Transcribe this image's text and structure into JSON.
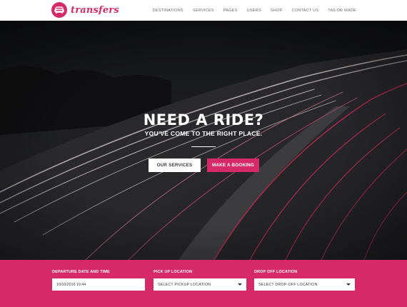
{
  "brand": {
    "name": "transfers",
    "accent": "#d52a67"
  },
  "nav": {
    "items": [
      "Destinations",
      "Services",
      "Pages",
      "Users",
      "Shop",
      "Contact us",
      "Tailor made"
    ]
  },
  "hero": {
    "title": "NEED A RIDE?",
    "subtitle": "YOU'VE COME TO THE RIGHT PLACE.",
    "primary_button": "OUR SERVICES",
    "secondary_button": "MAKE A BOOKING"
  },
  "booking": {
    "departure_label": "DEPARTURE DATE AND TIME",
    "departure_value": "10/10/2016 19:44",
    "pickup_label": "PICK UP LOCATION",
    "pickup_value": "Select pickup location",
    "dropoff_label": "DROP OFF LOCATION",
    "dropoff_value": "Select drop-off location"
  }
}
